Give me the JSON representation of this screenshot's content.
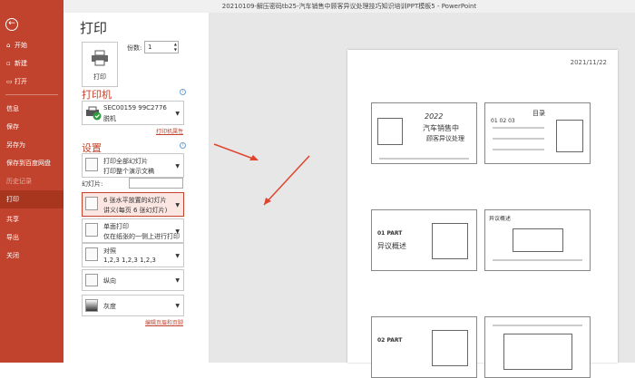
{
  "window": {
    "title": "20210109-解压密码tb25-汽车销售中顾客异议处理技巧知识培训PPT模板5  -  PowerPoint"
  },
  "sidebar": {
    "back_label": "←",
    "items": [
      {
        "label": "开始",
        "icon": "home-icon",
        "glyph": "⌂"
      },
      {
        "label": "新建",
        "icon": "new-file-icon",
        "glyph": "▫"
      },
      {
        "label": "打开",
        "icon": "open-folder-icon",
        "glyph": "▭"
      },
      {
        "label": "信息",
        "icon": "",
        "glyph": ""
      },
      {
        "label": "保存",
        "icon": "",
        "glyph": ""
      },
      {
        "label": "另存为",
        "icon": "",
        "glyph": ""
      },
      {
        "label": "保存到百度网盘",
        "icon": "",
        "glyph": ""
      },
      {
        "label": "历史记录",
        "icon": "",
        "glyph": ""
      },
      {
        "label": "打印",
        "icon": "",
        "glyph": "",
        "selected": true
      },
      {
        "label": "共享",
        "icon": "",
        "glyph": ""
      },
      {
        "label": "导出",
        "icon": "",
        "glyph": ""
      },
      {
        "label": "关闭",
        "icon": "",
        "glyph": ""
      }
    ]
  },
  "main": {
    "title": "打印",
    "print_button": {
      "label": "打印",
      "icon": "printer-icon"
    },
    "copies": {
      "label": "份数:",
      "value": "1"
    },
    "printer_section": "打印机",
    "printer": {
      "name": "SEC00159 99C2776",
      "status": "脱机",
      "icon": "printer-offline-icon"
    },
    "printer_properties_link": "打印机属性",
    "settings_section": "设置",
    "print_range": {
      "line1": "打印全部幻灯片",
      "line2": "打印整个演示文稿"
    },
    "slides": {
      "label": "幻灯片:",
      "value": ""
    },
    "layout": {
      "line1": "6 张水平放置的幻灯片",
      "line2": "讲义(每页 6 张幻灯片)"
    },
    "sides": {
      "line1": "单面打印",
      "line2": "仅在纸张的一侧上进行打印"
    },
    "collate": {
      "line1": "对照",
      "line2": "1,2,3    1,2,3    1,2,3"
    },
    "orientation": {
      "line1": "纵向"
    },
    "color": {
      "line1": "灰度"
    },
    "header_footer_link": "编辑页眉和页脚"
  },
  "preview": {
    "date": "2021/11/22",
    "thumbs": [
      {
        "title": "汽车销售中",
        "subtitle": "顾客异议处理",
        "tag": "2022"
      },
      {
        "title": "目录",
        "subtitle": "",
        "tag": "01 02 03"
      },
      {
        "title": "异议概述",
        "subtitle": "",
        "tag": "01 PART"
      },
      {
        "title": "异议概述",
        "subtitle": "",
        "tag": ""
      },
      {
        "title": "",
        "subtitle": "",
        "tag": "02 PART"
      },
      {
        "title": "",
        "subtitle": "",
        "tag": ""
      }
    ]
  },
  "colors": {
    "accent": "#c1432d",
    "accent_dark": "#a8361f",
    "preview_bg": "#e7e7e7"
  }
}
